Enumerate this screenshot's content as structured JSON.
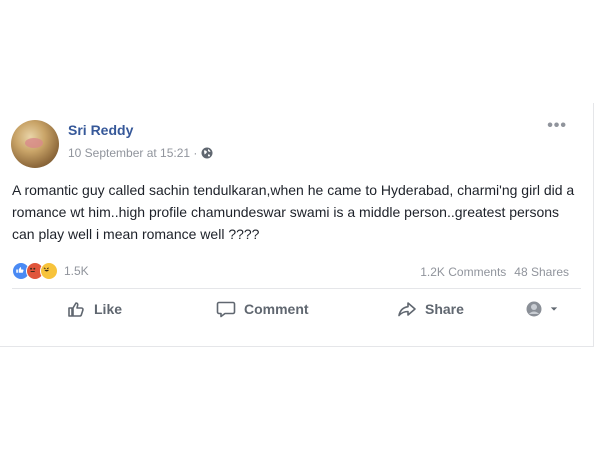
{
  "post": {
    "author": "Sri Reddy",
    "date": "10 September at 15:21 ·",
    "body": "A romantic guy called sachin tendulkaran,when he came to Hyderabad, charmi'ng girl did a romance wt him..high profile chamundeswar swami is a middle person..greatest persons can play well i mean romance well ????",
    "more_menu": "•••",
    "privacy_icon": "globe-icon"
  },
  "reactions": {
    "types": [
      "like",
      "angry",
      "haha"
    ],
    "count": "1.5K",
    "comments": "1.2K Comments",
    "shares": "48 Shares"
  },
  "actions": {
    "like": "Like",
    "comment": "Comment",
    "share": "Share"
  },
  "colors": {
    "author": "#365899",
    "meta": "#90949c",
    "text": "#1d2129",
    "action": "#606770",
    "like_reaction": "#4a8af4",
    "haha_reaction": "#f7c33b",
    "angry_reaction": "#e0553b"
  }
}
